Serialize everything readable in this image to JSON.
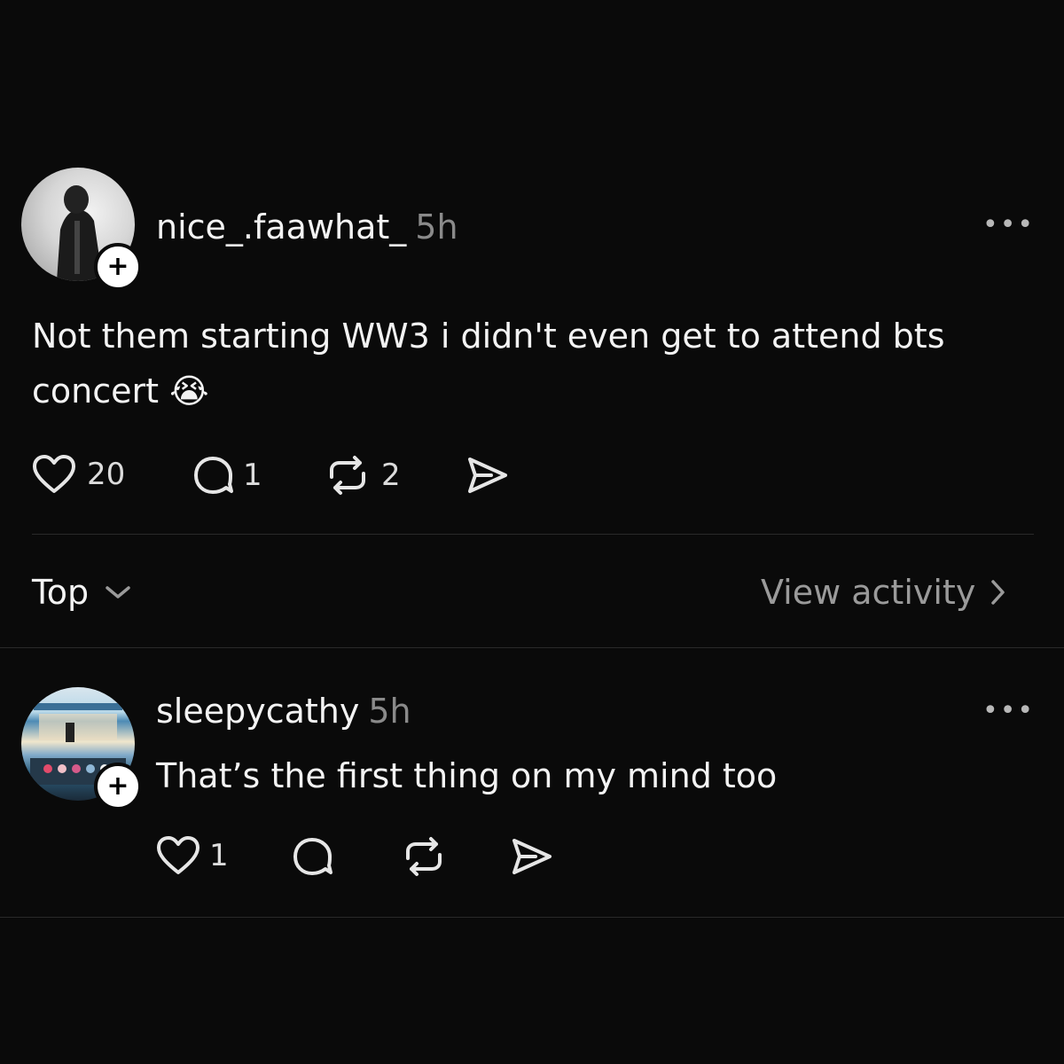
{
  "post": {
    "username": "nice_.faawhat_",
    "time": "5h",
    "more": "•••",
    "text_line1": "Not them starting  WW3 i didn't even get to attend bts",
    "text_line2": "concert 😭",
    "likes": "20",
    "comments": "1",
    "reposts": "2"
  },
  "filter": {
    "sort_label": "Top",
    "view_activity": "View activity"
  },
  "reply": {
    "username": "sleepycathy",
    "time": "5h",
    "more": "•••",
    "text": "That’s the first thing on my mind too",
    "likes": "1"
  },
  "icons": {
    "like": "heart-icon",
    "comment": "comment-bubble-icon",
    "repost": "repost-icon",
    "share": "send-icon",
    "follow": "plus-icon",
    "sort": "chevron-down-icon",
    "activity": "chevron-right-icon"
  }
}
